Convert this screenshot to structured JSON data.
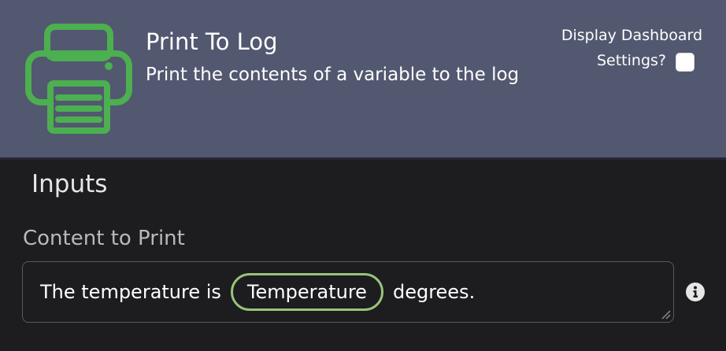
{
  "header": {
    "title": "Print To Log",
    "subtitle": "Print the contents of a variable to the log",
    "icon": "printer-icon",
    "icon_color": "#4caf50",
    "background": "#525870",
    "dashboard_label_line1": "Display Dashboard",
    "dashboard_label_line2": "Settings?",
    "dashboard_checked": false
  },
  "inputs": {
    "section_title": "Inputs",
    "fields": [
      {
        "label": "Content to Print",
        "text_before": "The temperature is",
        "variable": "Temperature",
        "text_after": "degrees.",
        "variable_pill_color": "#98c379",
        "info_icon": "info-icon"
      }
    ]
  }
}
